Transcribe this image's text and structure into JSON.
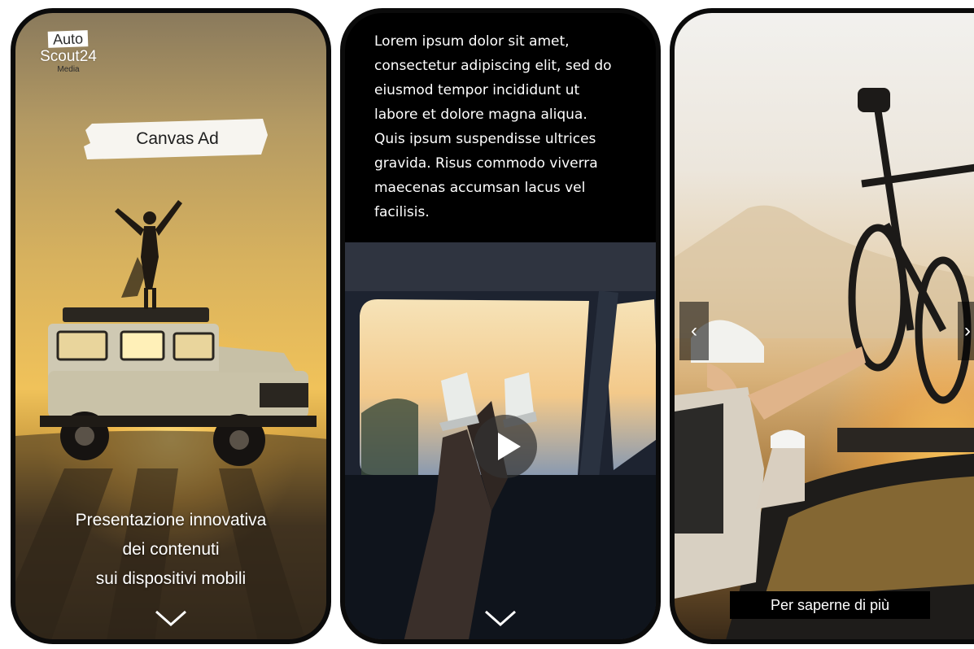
{
  "phone1": {
    "logo": {
      "top": "Auto",
      "middle": "Scout24",
      "bottom": "Media"
    },
    "tag_label": "Canvas Ad",
    "caption_lines": [
      "Presentazione innovativa",
      "dei contenuti",
      "sui dispositivi mobili"
    ],
    "scroll_icon": "chevron-down-icon"
  },
  "phone2": {
    "body_lines": [
      "Lorem ipsum dolor sit amet,",
      "consectetur adipiscing elit, sed do",
      "eiusmod tempor incididunt ut",
      "labore et dolore magna aliqua.",
      "Quis ipsum suspendisse ultrices",
      "gravida. Risus commodo viverra",
      "maecenas accumsan lacus vel",
      "facilisis."
    ],
    "video_icon": "play-icon",
    "scroll_icon": "chevron-down-icon"
  },
  "phone3": {
    "prev_icon": "‹",
    "next_icon": "›",
    "cta_label": "Per saperne di più"
  }
}
